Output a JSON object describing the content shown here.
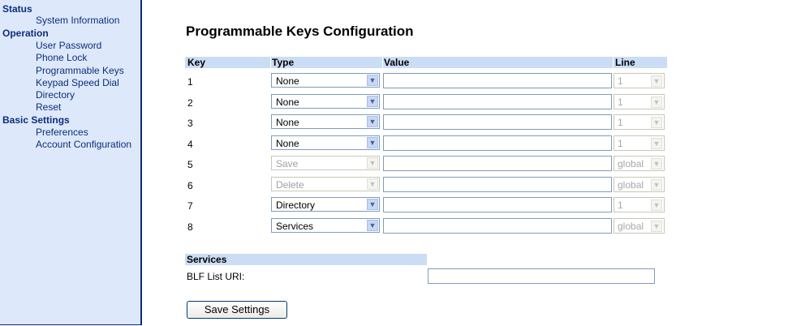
{
  "sidebar": {
    "status": {
      "title": "Status",
      "items": [
        "System Information"
      ]
    },
    "operation": {
      "title": "Operation",
      "items": [
        "User Password",
        "Phone Lock",
        "Programmable Keys",
        "Keypad Speed Dial",
        "Directory",
        "Reset"
      ]
    },
    "basic": {
      "title": "Basic Settings",
      "items": [
        "Preferences",
        "Account Configuration"
      ]
    }
  },
  "page_title": "Programmable Keys Configuration",
  "table": {
    "headers": {
      "key": "Key",
      "type": "Type",
      "value": "Value",
      "line": "Line"
    },
    "rows": [
      {
        "key": "1",
        "type": "None",
        "type_enabled": true,
        "value": "",
        "line": "1"
      },
      {
        "key": "2",
        "type": "None",
        "type_enabled": true,
        "value": "",
        "line": "1"
      },
      {
        "key": "3",
        "type": "None",
        "type_enabled": true,
        "value": "",
        "line": "1"
      },
      {
        "key": "4",
        "type": "None",
        "type_enabled": true,
        "value": "",
        "line": "1"
      },
      {
        "key": "5",
        "type": "Save",
        "type_enabled": false,
        "value": "",
        "line": "global"
      },
      {
        "key": "6",
        "type": "Delete",
        "type_enabled": false,
        "value": "",
        "line": "global"
      },
      {
        "key": "7",
        "type": "Directory",
        "type_enabled": true,
        "value": "",
        "line": "1"
      },
      {
        "key": "8",
        "type": "Services",
        "type_enabled": true,
        "value": "",
        "line": "global"
      }
    ]
  },
  "services": {
    "title": "Services",
    "blf_label": "BLF List URI:",
    "blf_value": ""
  },
  "save_button": "Save Settings",
  "colors": {
    "sidebar_bg": "#dde9fa",
    "nav_text": "#0d2d7e",
    "header_bg": "#cbdcf5",
    "border": "#0a2a7a"
  }
}
